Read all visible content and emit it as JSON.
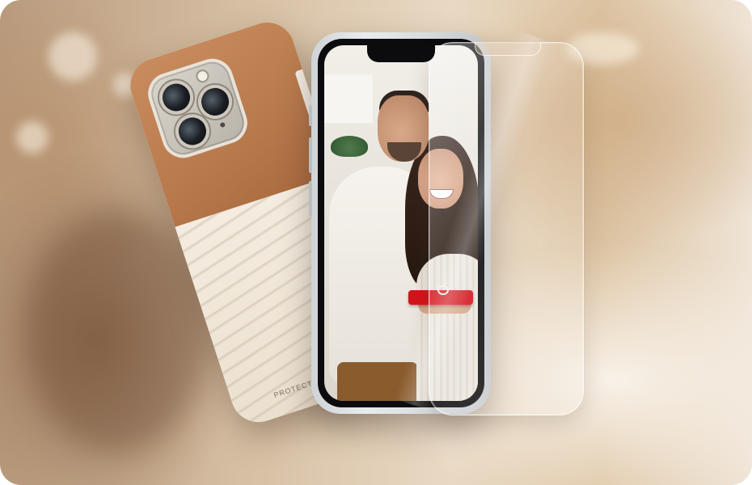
{
  "scene": {
    "case_print": "PROTECTED",
    "colors": {
      "leather": "#b87a4d",
      "case_body": "#efe6d8",
      "gift": "#d4141b",
      "background_warm": "#d8c2a6"
    },
    "icons": [
      "camera-lens-icon",
      "flash-icon"
    ]
  }
}
